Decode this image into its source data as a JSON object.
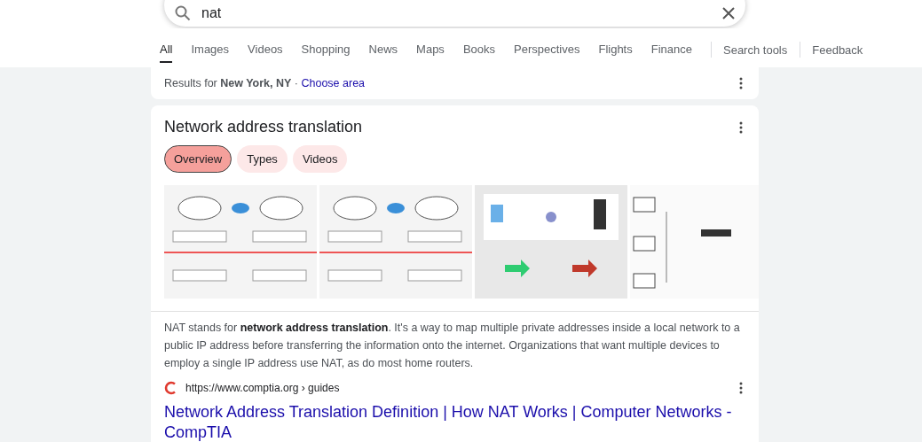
{
  "search": {
    "value": "nat"
  },
  "tabs": [
    {
      "label": "All",
      "selected": true
    },
    {
      "label": "Images",
      "selected": false
    },
    {
      "label": "Videos",
      "selected": false
    },
    {
      "label": "Shopping",
      "selected": false
    },
    {
      "label": "News",
      "selected": false
    },
    {
      "label": "Maps",
      "selected": false
    },
    {
      "label": "Books",
      "selected": false
    },
    {
      "label": "Perspectives",
      "selected": false
    },
    {
      "label": "Flights",
      "selected": false
    },
    {
      "label": "Finance",
      "selected": false
    }
  ],
  "tools": [
    "Search tools",
    "Feedback"
  ],
  "location": {
    "prefix": "Results for **New York, NY** ·",
    "link": "Choose area"
  },
  "knowledge": {
    "title": "Network address translation",
    "chips": [
      {
        "label": "Overview",
        "selected": true
      },
      {
        "label": "Types",
        "selected": false
      },
      {
        "label": "Videos",
        "selected": false
      }
    ]
  },
  "result": {
    "snippet": "NAT stands for **network address translation**. It's a way to map multiple private addresses inside a local network to a public IP address before transferring the information onto the internet. Organizations that want multiple devices to employ a single IP address use NAT, as do most home routers.",
    "url": "https://www.comptia.org › guides",
    "title": "Network Address Translation Definition | How NAT Works | Computer Networks - CompTIA"
  }
}
